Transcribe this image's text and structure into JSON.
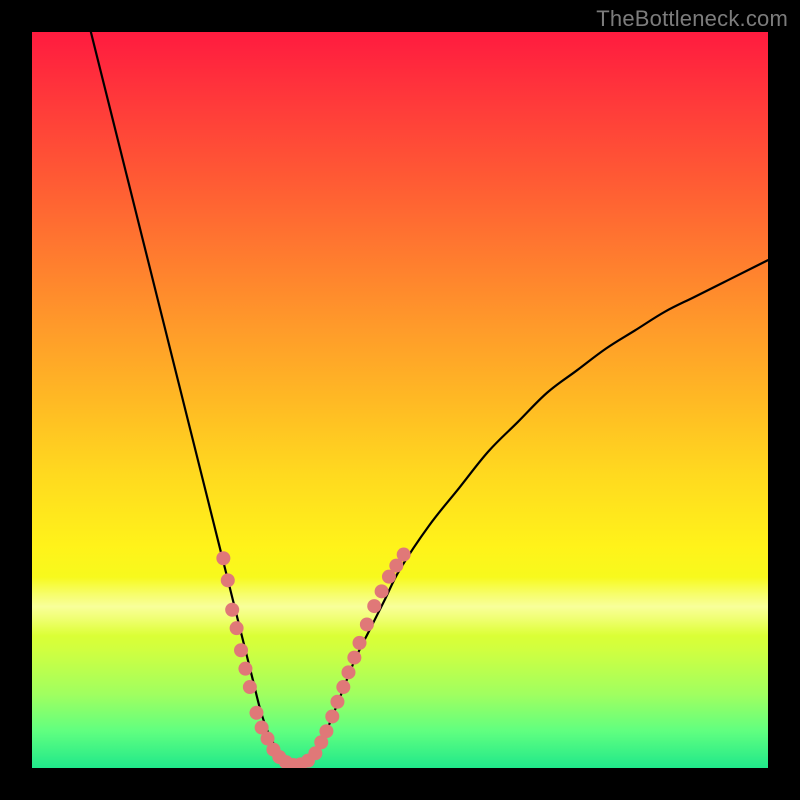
{
  "watermark": "TheBottleneck.com",
  "colors": {
    "background": "#000000",
    "curve_stroke": "#000000",
    "marker_fill": "#e07878",
    "gradient_top": "#ff1b3f",
    "gradient_bottom": "#20e88a"
  },
  "chart_data": {
    "type": "line",
    "title": "",
    "xlabel": "",
    "ylabel": "",
    "xlim": [
      0,
      100
    ],
    "ylim": [
      0,
      100
    ],
    "grid": false,
    "legend": false,
    "series": [
      {
        "name": "curve",
        "x": [
          8,
          10,
          12,
          14,
          16,
          18,
          20,
          22,
          24,
          25,
          26,
          27,
          28,
          29,
          30,
          31,
          32,
          33,
          34,
          35,
          36,
          37,
          38,
          39,
          40,
          42,
          44,
          46,
          48,
          50,
          54,
          58,
          62,
          66,
          70,
          74,
          78,
          82,
          86,
          90,
          94,
          98,
          100
        ],
        "y": [
          100,
          92,
          84,
          76,
          68,
          60,
          52,
          44,
          36,
          32,
          28,
          24,
          20,
          16,
          12,
          8,
          5,
          3,
          1.5,
          0.6,
          0.2,
          0.6,
          1.5,
          3,
          5,
          10,
          15,
          19,
          23,
          27,
          33,
          38,
          43,
          47,
          51,
          54,
          57,
          59.5,
          62,
          64,
          66,
          68,
          69
        ]
      }
    ],
    "markers": [
      {
        "x": 26.0,
        "y": 28.5
      },
      {
        "x": 26.6,
        "y": 25.5
      },
      {
        "x": 27.2,
        "y": 21.5
      },
      {
        "x": 27.8,
        "y": 19.0
      },
      {
        "x": 28.4,
        "y": 16.0
      },
      {
        "x": 29.0,
        "y": 13.5
      },
      {
        "x": 29.6,
        "y": 11.0
      },
      {
        "x": 30.5,
        "y": 7.5
      },
      {
        "x": 31.2,
        "y": 5.5
      },
      {
        "x": 32.0,
        "y": 4.0
      },
      {
        "x": 32.8,
        "y": 2.5
      },
      {
        "x": 33.6,
        "y": 1.5
      },
      {
        "x": 34.5,
        "y": 0.8
      },
      {
        "x": 35.5,
        "y": 0.4
      },
      {
        "x": 36.5,
        "y": 0.5
      },
      {
        "x": 37.5,
        "y": 1.0
      },
      {
        "x": 38.5,
        "y": 2.0
      },
      {
        "x": 39.3,
        "y": 3.5
      },
      {
        "x": 40.0,
        "y": 5.0
      },
      {
        "x": 40.8,
        "y": 7.0
      },
      {
        "x": 41.5,
        "y": 9.0
      },
      {
        "x": 42.3,
        "y": 11.0
      },
      {
        "x": 43.0,
        "y": 13.0
      },
      {
        "x": 43.8,
        "y": 15.0
      },
      {
        "x": 44.5,
        "y": 17.0
      },
      {
        "x": 45.5,
        "y": 19.5
      },
      {
        "x": 46.5,
        "y": 22.0
      },
      {
        "x": 47.5,
        "y": 24.0
      },
      {
        "x": 48.5,
        "y": 26.0
      },
      {
        "x": 49.5,
        "y": 27.5
      },
      {
        "x": 50.5,
        "y": 29.0
      }
    ]
  }
}
